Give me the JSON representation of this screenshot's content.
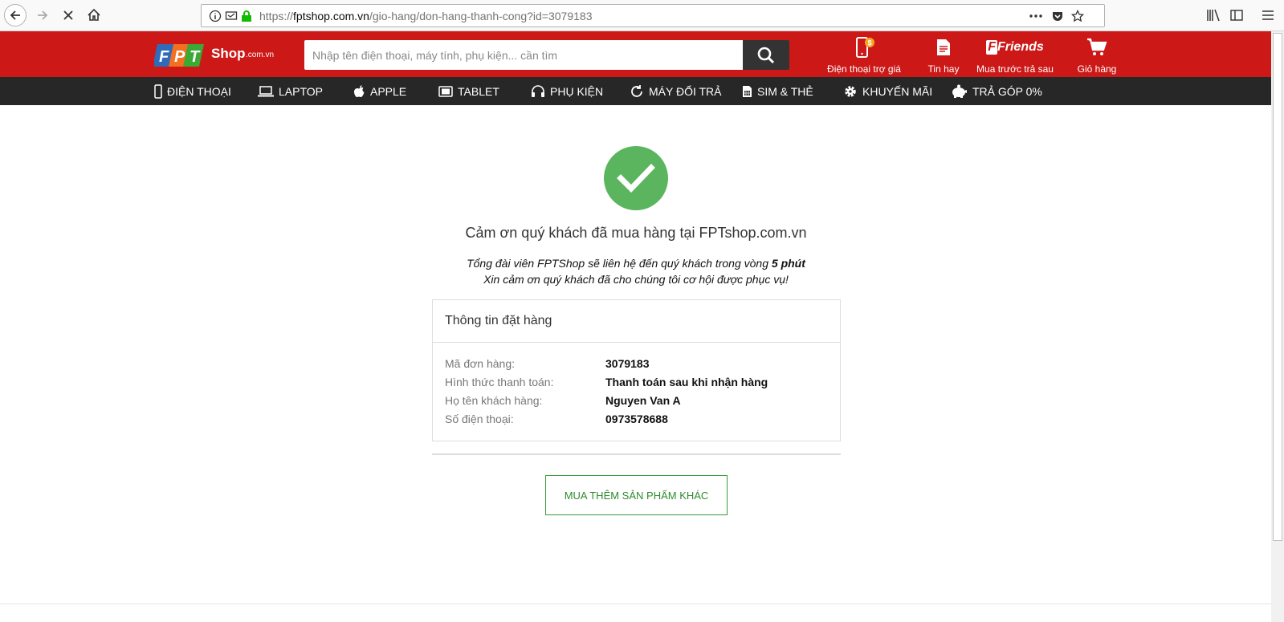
{
  "browser": {
    "url_prefix": "https://",
    "url_host": "fptshop.com.vn",
    "url_path": "/gio-hang/don-hang-thanh-cong?id=3079183"
  },
  "header": {
    "logo_text": "Shop",
    "logo_suffix": ".com.vn",
    "search_placeholder": "Nhập tên điện thoại, máy tính, phụ kiện... cần tìm",
    "links": [
      {
        "label": "Điện thoại trợ giá",
        "icon": "phone-dollar-icon"
      },
      {
        "label": "Tin hay",
        "icon": "document-icon"
      },
      {
        "label": "Mua trước trả sau",
        "icon": "fptfriends-logo",
        "brand": "Friends"
      },
      {
        "label": "Giỏ hàng",
        "icon": "cart-icon"
      }
    ]
  },
  "categories": [
    {
      "label": "ĐIỆN THOẠI",
      "icon": "phone-icon"
    },
    {
      "label": "LAPTOP",
      "icon": "laptop-icon"
    },
    {
      "label": "APPLE",
      "icon": "apple-icon"
    },
    {
      "label": "TABLET",
      "icon": "tablet-icon"
    },
    {
      "label": "PHỤ KIỆN",
      "icon": "headphones-icon"
    },
    {
      "label": "MÁY ĐỔI TRẢ",
      "icon": "refresh-icon"
    },
    {
      "label": "SIM & THẺ",
      "icon": "sim-icon"
    },
    {
      "label": "KHUYẾN MÃI",
      "icon": "gear-icon"
    },
    {
      "label": "TRẢ GÓP 0%",
      "icon": "piggy-bank-icon"
    }
  ],
  "confirmation": {
    "title": "Cảm ơn quý khách đã mua hàng tại FPTshop.com.vn",
    "line1_prefix": "Tổng đài viên FPTShop sẽ liên hệ đến quý khách trong vòng",
    "line1_bold": "5 phút",
    "line2": "Xin cảm ơn quý khách đã cho chúng tôi cơ hội được phục vụ!"
  },
  "order_info": {
    "heading": "Thông tin đặt hàng",
    "rows": [
      {
        "label": "Mã đơn hàng:",
        "value": "3079183"
      },
      {
        "label": "Hình thức thanh toán:",
        "value": "Thanh toán sau khi nhận hàng"
      },
      {
        "label": "Họ tên khách hàng:",
        "value": "Nguyen Van A"
      },
      {
        "label": "Số điện thoại:",
        "value": "0973578688"
      }
    ]
  },
  "more_button": "MUA THÊM SẢN PHẨM KHÁC",
  "colors": {
    "header_red": "#cd1818",
    "nav_dark": "#272727",
    "success_green": "#5ab55e"
  }
}
